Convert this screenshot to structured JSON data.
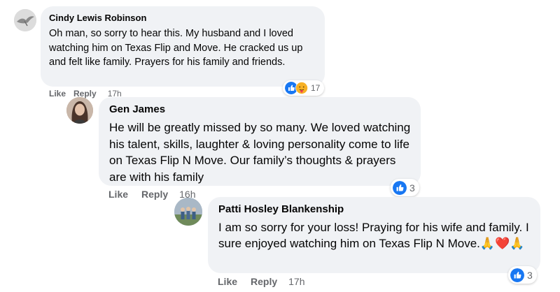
{
  "comments": [
    {
      "author": "Cindy Lewis Robinson",
      "text": "Oh man, so sorry to hear this. My husband and I loved watching him on Texas Flip and Move. He cracked us up and felt like family. Prayers for his family and friends.",
      "like_label": "Like",
      "reply_label": "Reply",
      "time": "17h",
      "reactions": [
        "like",
        "care"
      ],
      "reaction_count": "17"
    },
    {
      "author": "Gen James",
      "text": "He will be greatly missed by so many. We loved watching his talent, skills, laughter & loving personality come to life on Texas Flip N Move. Our family’s thoughts & prayers are with his family",
      "like_label": "Like",
      "reply_label": "Reply",
      "time": "16h",
      "reactions": [
        "like"
      ],
      "reaction_count": "3"
    },
    {
      "author": "Patti Hosley Blankenship",
      "text": "I am so sorry for your loss! Praying for his wife and family. I sure enjoyed watching him on Texas Flip N Move.🙏❤️🙏",
      "like_label": "Like",
      "reply_label": "Reply",
      "time": "17h",
      "reactions": [
        "like"
      ],
      "reaction_count": "3"
    }
  ],
  "colors": {
    "bubble": "#f0f2f5",
    "secondary_text": "#65676b",
    "like_blue": "#1877f2",
    "care_yellow": "#f7b125"
  }
}
